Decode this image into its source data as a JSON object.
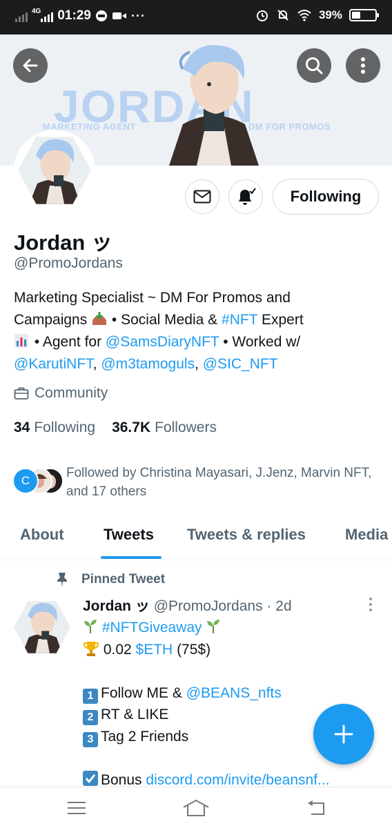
{
  "status_bar": {
    "network": "4G",
    "time": "01:29",
    "battery": "39%",
    "battery_level": 0.39
  },
  "banner": {
    "wordmark": "JORDAN",
    "tag_left": "MARKETING AGENT",
    "tag_right": "DM FOR PROMOS"
  },
  "profile": {
    "name": "Jordan ッ",
    "handle": "@PromoJordans",
    "follow_button": "Following",
    "bio": {
      "line1": "Marketing Specialist ~ DM For Promos and",
      "line2_a": "Campaigns",
      "line2_b": " • Social Media & ",
      "line2_hashtag": "#NFT",
      "line2_c": " Expert",
      "line3_a": " • Agent for ",
      "line3_mention": "@SamsDiaryNFT",
      "line3_b": " • Worked w/",
      "line4_m1": "@KarutiNFT",
      "line4_sep1": ", ",
      "line4_m2": "@m3tamoguls",
      "line4_sep2": ", ",
      "line4_m3": "@SIC_NFT"
    },
    "category": "Community",
    "following_count": "34",
    "following_label": "Following",
    "followers_count": "36.7K",
    "followers_label": "Followers",
    "followed_by": "Followed by Christina Mayasari, J.Jenz, Marvin NFT, and 17 others",
    "followed_by_initial": "C"
  },
  "tabs": [
    "About",
    "Tweets",
    "Tweets & replies",
    "Media"
  ],
  "active_tab": "Tweets",
  "pinned_tweet": {
    "pinned_label": "Pinned Tweet",
    "author_name": "Jordan ッ",
    "author_handle": "@PromoJordans",
    "time_ago": "· 2d",
    "line1_hashtag": "#NFTGiveaway",
    "line2_amount": " 0.02 ",
    "line2_cashtag": "$ETH",
    "line2_value": " (75$)",
    "step1_num": "1",
    "step1_text": "Follow ME & ",
    "step1_mention": "@BEANS_nfts",
    "step2_num": "2",
    "step2_text": "RT & LIKE",
    "step3_num": "3",
    "step3_text": "Tag 2 Friends",
    "bonus_text": "Bonus ",
    "bonus_link": "discord.com/invite/beansnf..."
  },
  "colors": {
    "accent": "#1d9bf0",
    "text_primary": "#0f1419",
    "text_secondary": "#536471",
    "banner_text": "#b9d2f1"
  }
}
